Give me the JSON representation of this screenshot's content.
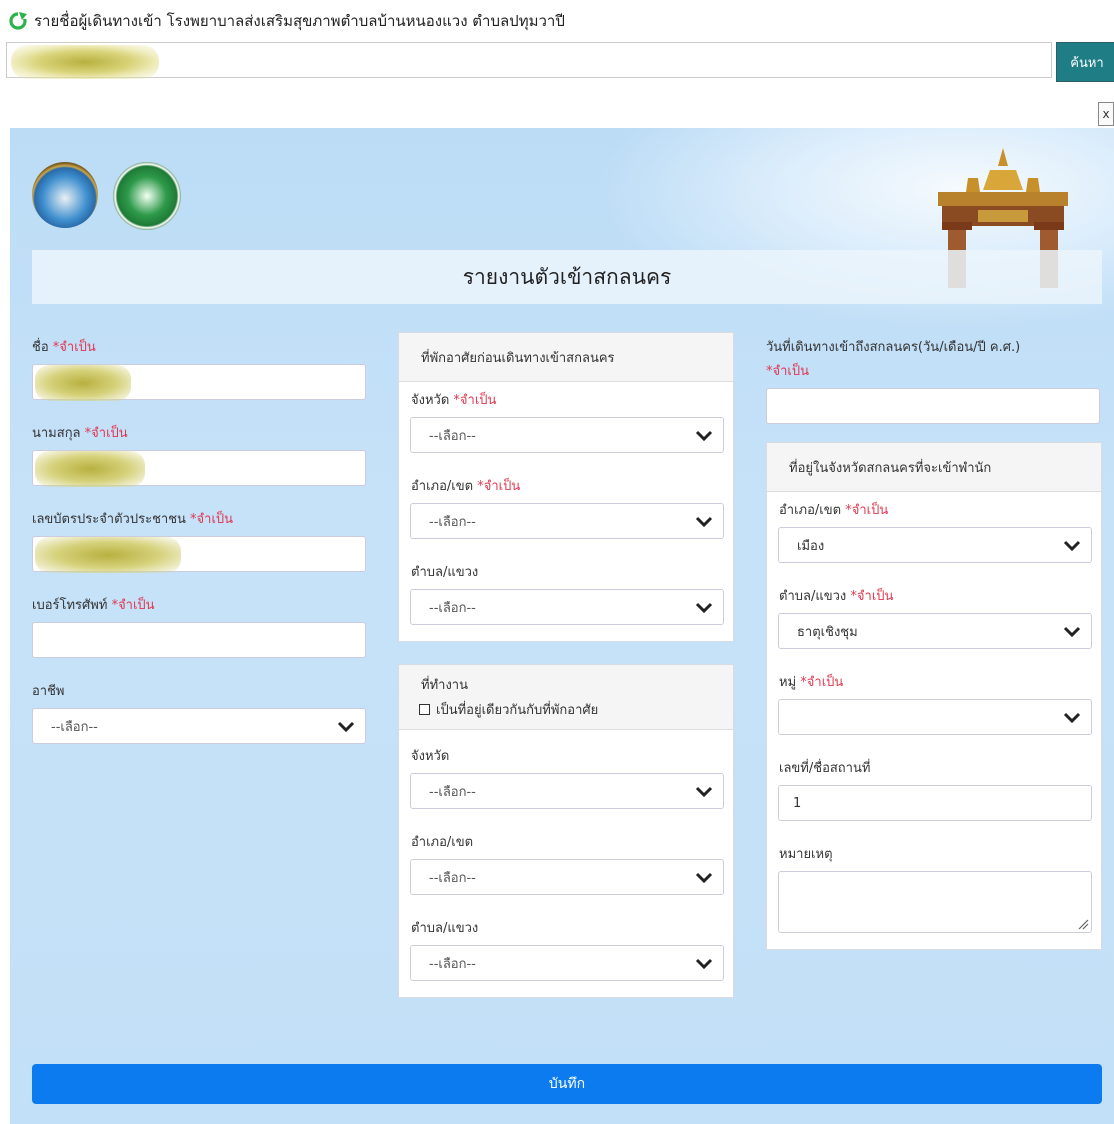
{
  "top": {
    "title": "รายชื่อผู้เดินทางเข้า โรงพยาบาลส่งเสริมสุขภาพตำบลบ้านหนองแวง ตำบลปทุมวาปี",
    "search_button": "ค้นหา",
    "close_label": "x"
  },
  "form": {
    "heading": "รายงานตัวเข้าสกลนคร",
    "required_text": "*จำเป็น",
    "select_placeholder": "--เลือก--",
    "fields": {
      "first_name": "ชื่อ",
      "last_name": "นามสกุล",
      "id_card": "เลขบัตรประจำตัวประชาชน",
      "phone": "เบอร์โทรศัพท์",
      "occupation": "อาชีพ",
      "travel_date": "วันที่เดินทางเข้าถึงสกลนคร(วัน/เดือน/ปี ค.ศ.)"
    },
    "residence_card": {
      "title": "ที่พักอาศัยก่อนเดินทางเข้าสกลนคร",
      "province": "จังหวัด",
      "district": "อำเภอ/เขต",
      "subdistrict": "ตำบล/แขวง"
    },
    "work_card": {
      "title": "ที่ทำงาน",
      "same_address": "เป็นที่อยู่เดียวกันกับที่พักอาศัย",
      "province": "จังหวัด",
      "district": "อำเภอ/เขต",
      "subdistrict": "ตำบล/แขวง"
    },
    "sakon_card": {
      "title": "ที่อยู่ในจังหวัดสกลนครที่จะเข้าพำนัก",
      "district": "อำเภอ/เขต",
      "district_value": "เมือง",
      "subdistrict": "ตำบล/แขวง",
      "subdistrict_value": "ธาตุเชิงชุม",
      "village": "หมู่",
      "village_value": "",
      "house_no": "เลขที่/ชื่อสถานที่",
      "house_no_value": "1",
      "remark": "หมายเหตุ"
    },
    "submit": "บันทึก"
  },
  "colors": {
    "search_button": "#1f7d86",
    "submit_button": "#0d7bf0",
    "required": "#e0374f",
    "panel_bg": "#c2e0f7"
  }
}
